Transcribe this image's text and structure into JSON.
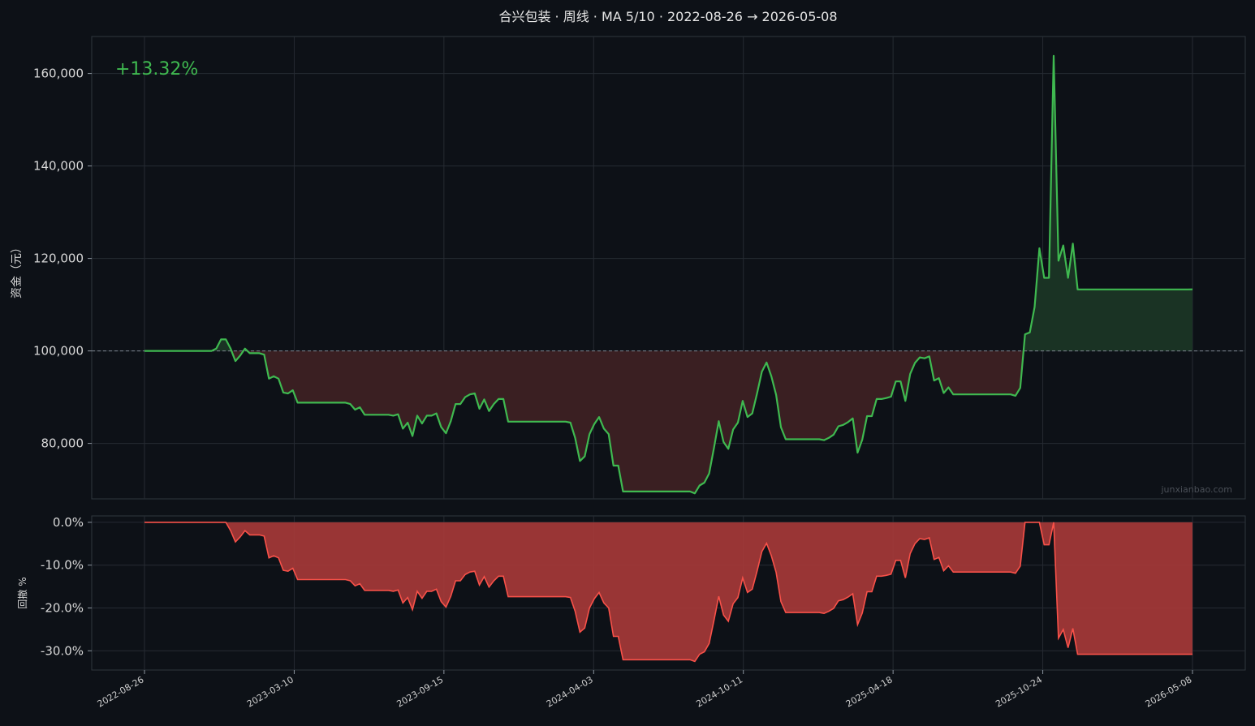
{
  "title": "合兴包装 · 周线 · MA 5/10 · 2022-08-26 → 2026-05-08",
  "return_label": "+13.32%",
  "watermark": "junxianbao.com",
  "colors": {
    "bg": "#0d1117",
    "panel": "#0d1117",
    "grid": "#262b33",
    "equity": "#3fb950",
    "loss_fill": "#3a1f22",
    "gain_fill": "#1a3324",
    "drawdown": "#f85149",
    "drawdown_fill": "#a83a38",
    "baseline": "#7d8590"
  },
  "chart_data": [
    {
      "type": "line",
      "ylabel": "资金（元）",
      "ylim": [
        68000,
        168000
      ],
      "yticks": [
        80000,
        100000,
        120000,
        140000,
        160000
      ],
      "ytick_labels": [
        "80,000",
        "100,000",
        "120,000",
        "140,000",
        "160,000"
      ],
      "baseline": 100000,
      "xlabels": [
        "2022-08-26",
        "2023-03-10",
        "2023-09-15",
        "2024-04-03",
        "2024-10-11",
        "2025-04-18",
        "2025-10-24",
        "2026-05-08"
      ],
      "grid": true,
      "series": [
        {
          "values": [
            100000,
            100000,
            100000,
            100000,
            100000,
            100000,
            100000,
            100000,
            100000,
            100000,
            100000,
            100000,
            100000,
            100000,
            100000,
            100500,
            102500,
            102500,
            100500,
            97800,
            99000,
            100500,
            99500,
            99500,
            99500,
            99200,
            94000,
            94500,
            94000,
            91000,
            90800,
            91500,
            88800,
            88800,
            88800,
            88800,
            88800,
            88800,
            88800,
            88800,
            88800,
            88800,
            88800,
            88500,
            87300,
            87800,
            86200,
            86200,
            86200,
            86200,
            86200,
            86200,
            86000,
            86300,
            83200,
            84500,
            81600,
            86000,
            84300,
            86000,
            86000,
            86500,
            83500,
            82200,
            84800,
            88500,
            88500,
            90000,
            90600,
            90800,
            87500,
            89500,
            87000,
            88500,
            89600,
            89600,
            84700,
            84700,
            84700,
            84700,
            84700,
            84700,
            84700,
            84700,
            84700,
            84700,
            84700,
            84700,
            84700,
            84500,
            81200,
            76200,
            77200,
            82000,
            84200,
            85700,
            83200,
            82000,
            75200,
            75200,
            69600,
            69600,
            69600,
            69600,
            69600,
            69600,
            69600,
            69600,
            69600,
            69600,
            69600,
            69600,
            69600,
            69600,
            69600,
            69200,
            70900,
            71500,
            73500,
            79000,
            84800,
            80300,
            78800,
            83000,
            84500,
            89200,
            85700,
            86500,
            90800,
            95500,
            97500,
            94500,
            90500,
            83500,
            80900,
            80900,
            80900,
            80900,
            80900,
            80900,
            80900,
            80900,
            80700,
            81200,
            81900,
            83700,
            84000,
            84600,
            85400,
            78000,
            80800,
            85900,
            85900,
            89600,
            89600,
            89800,
            90100,
            93400,
            93400,
            89200,
            95000,
            97400,
            98600,
            98400,
            98800,
            93600,
            94100,
            90900,
            92100,
            90600,
            90600,
            90600,
            90600,
            90600,
            90600,
            90600,
            90600,
            90600,
            90600,
            90600,
            90600,
            90600,
            90300,
            92000,
            103600,
            104000,
            109500,
            122200,
            115800,
            115800,
            163800,
            119500,
            122800,
            115800,
            123200,
            113300,
            113300,
            113300,
            113300,
            113300,
            113300,
            113300,
            113300,
            113300,
            113300,
            113300,
            113300,
            113300,
            113300,
            113300,
            113300,
            113300,
            113300,
            113300,
            113300,
            113300,
            113300,
            113300,
            113300,
            113320
          ]
        }
      ]
    },
    {
      "type": "area",
      "ylabel": "回撤 %",
      "ylim": [
        -34.5,
        1.5
      ],
      "yticks": [
        0,
        -10,
        -20,
        -30
      ],
      "ytick_labels": [
        "0.0%",
        "-10.0%",
        "-20.0%",
        "-30.0%"
      ],
      "xlabels": [
        "2022-08-26",
        "2023-03-10",
        "2023-09-15",
        "2024-04-03",
        "2024-10-11",
        "2025-04-18",
        "2025-10-24",
        "2026-05-08"
      ],
      "grid": true
    }
  ]
}
